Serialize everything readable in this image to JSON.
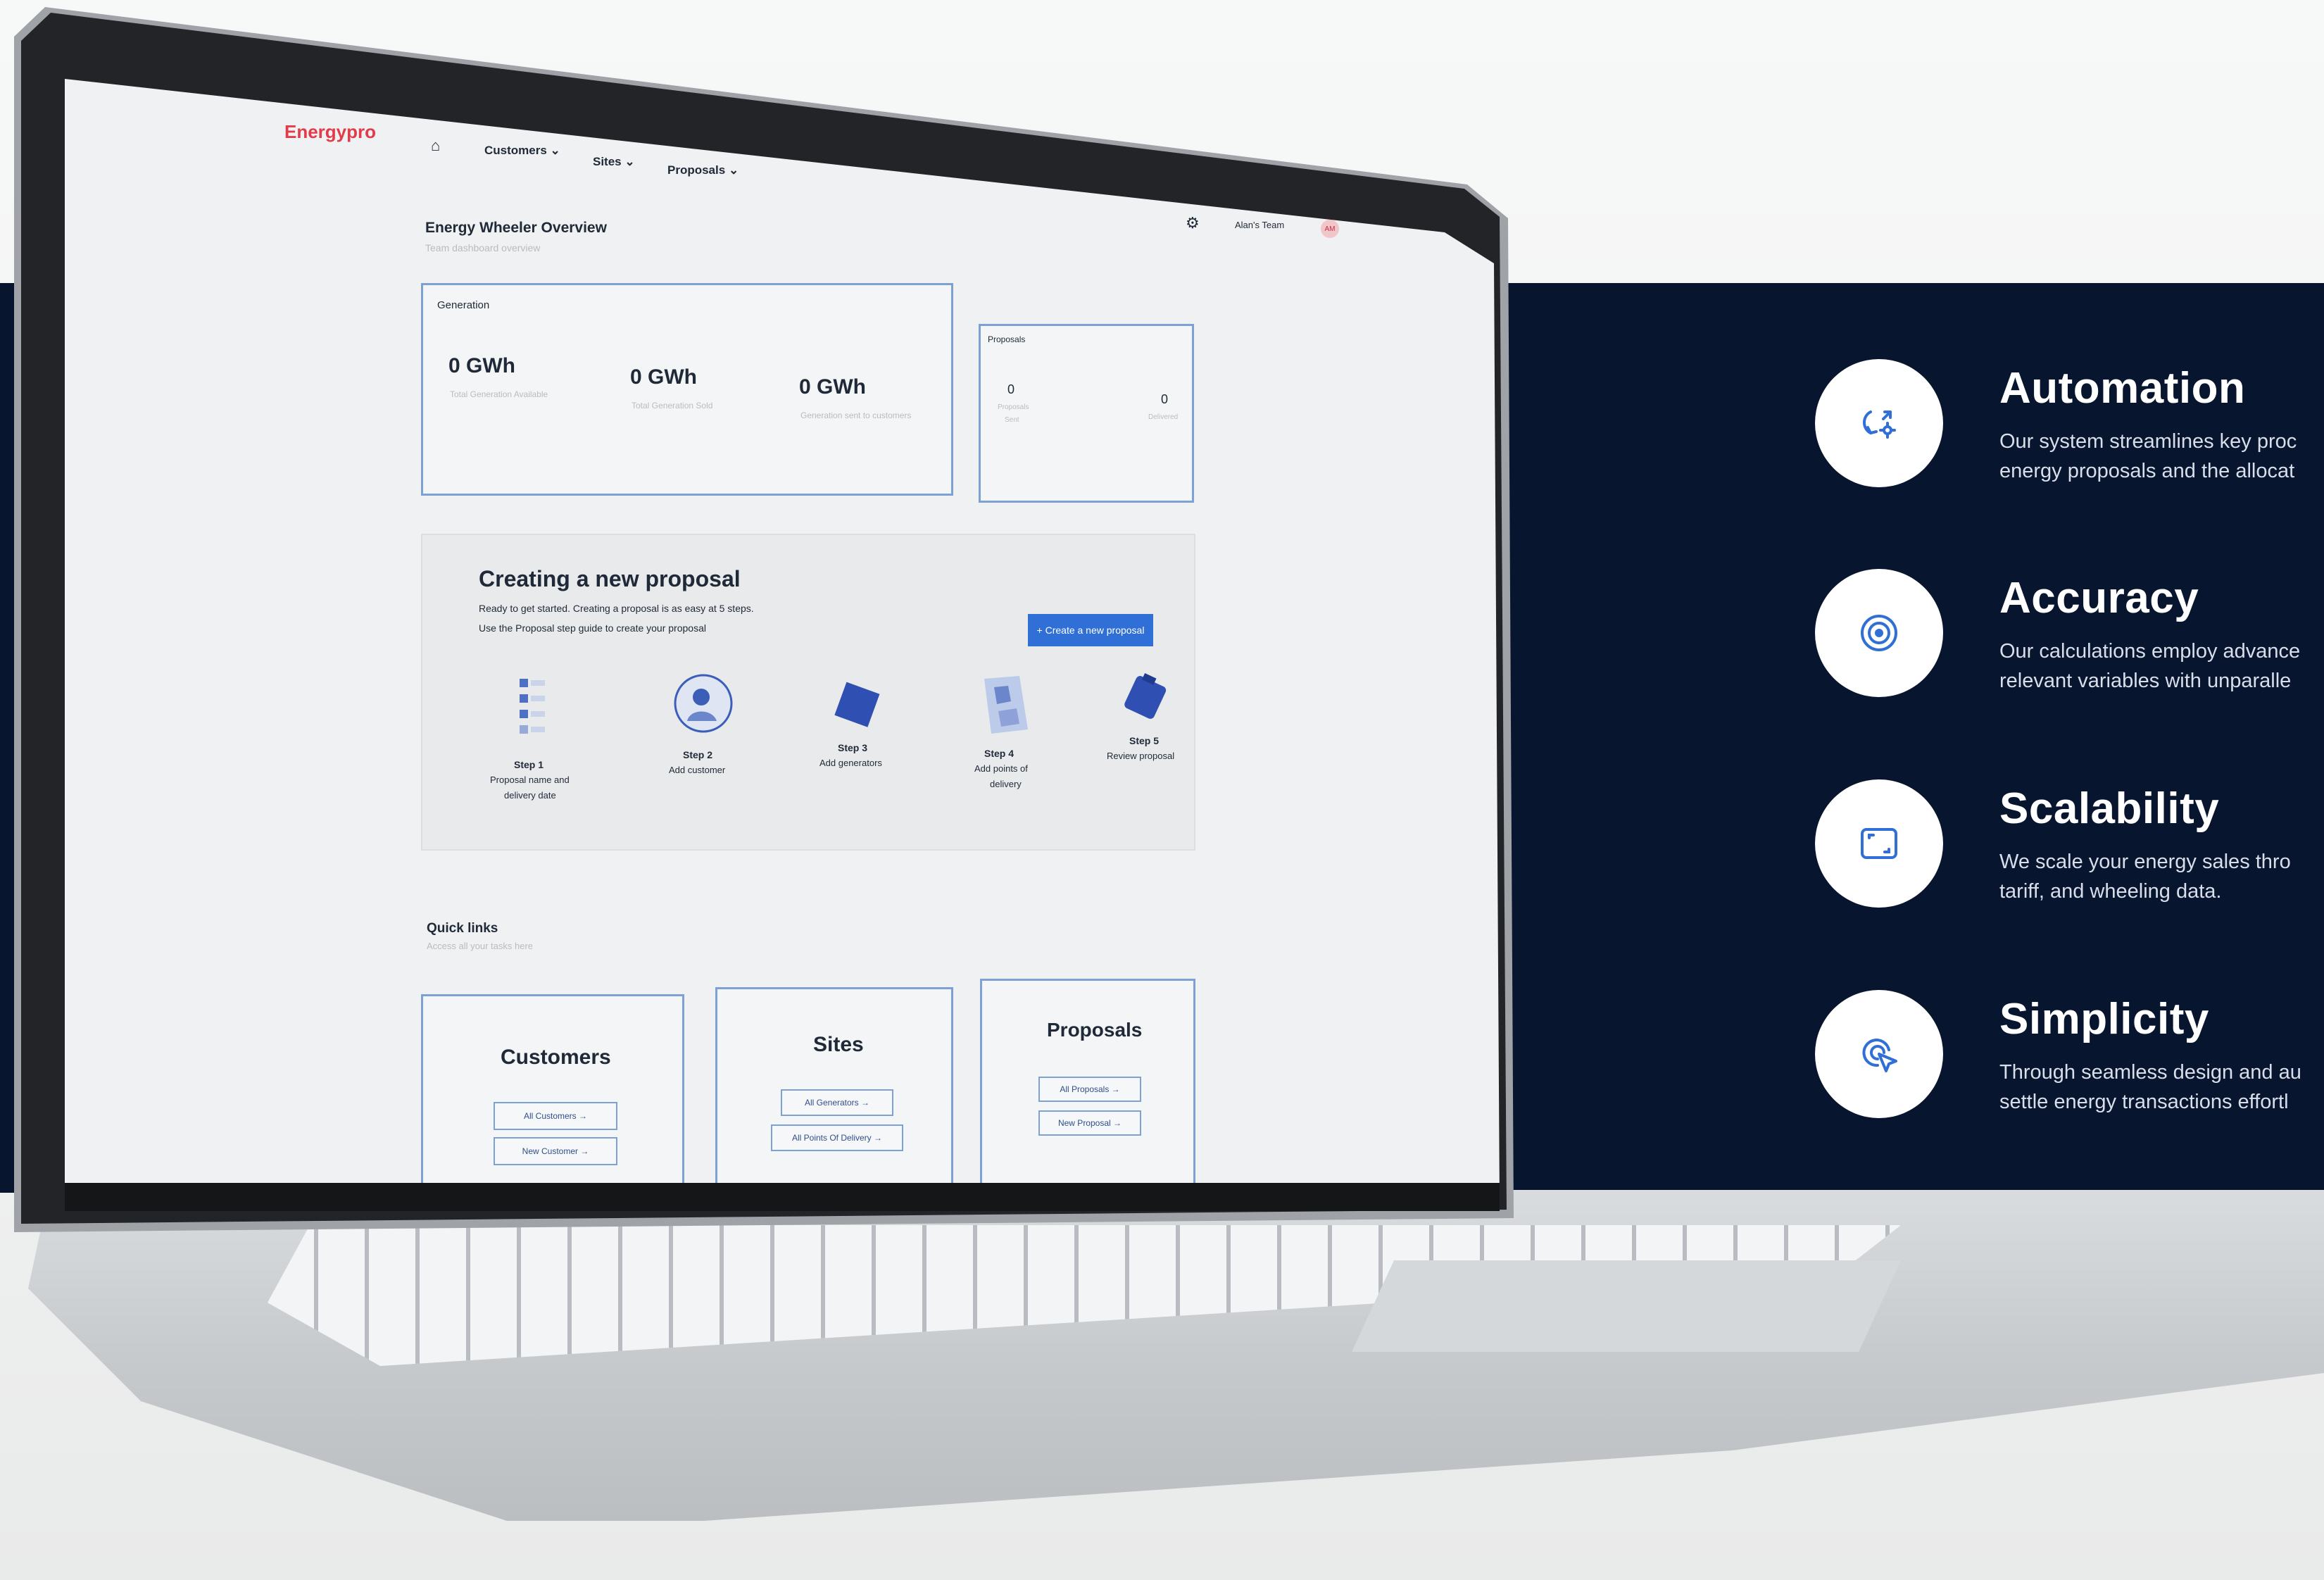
{
  "features": [
    {
      "title": "Automation",
      "desc": [
        "Our system streamlines key proc",
        "energy proposals and the allocat"
      ],
      "icon": "automation-icon"
    },
    {
      "title": "Accuracy",
      "desc": [
        "Our calculations employ advance",
        "relevant variables with unparalle"
      ],
      "icon": "target-icon"
    },
    {
      "title": "Scalability",
      "desc": [
        "We scale your energy sales thro",
        "tariff, and wheeling data."
      ],
      "icon": "scale-frame-icon"
    },
    {
      "title": "Simplicity",
      "desc": [
        "Through seamless design and au",
        "settle energy transactions effortl"
      ],
      "icon": "click-pointer-icon"
    }
  ],
  "app": {
    "logo": "Energypro",
    "nav": [
      "Customers",
      "Sites",
      "Proposals"
    ],
    "team": "Alan's Team",
    "avatar": "AM",
    "page_title": "Energy Wheeler Overview",
    "page_subtitle": "Team dashboard overview",
    "generation": {
      "title": "Generation",
      "stats": [
        {
          "value": "0 GWh",
          "label": "Total Generation Available"
        },
        {
          "value": "0 GWh",
          "label": "Total Generation Sold"
        },
        {
          "value": "0 GWh",
          "label": "Generation sent to customers"
        }
      ]
    },
    "proposals_card": {
      "title": "Proposals",
      "stats": [
        {
          "value": "0",
          "label": "Proposals",
          "label2": "Sent"
        },
        {
          "value": "0",
          "label": "Delivered",
          "label2": ""
        }
      ]
    },
    "create": {
      "title": "Creating a new proposal",
      "line1": "Ready to get started. Creating a proposal is as easy at 5 steps.",
      "line2": "Use the Proposal step guide to create your proposal",
      "button": "+ Create a new proposal",
      "steps": [
        {
          "title": "Step 1",
          "desc": "Proposal name and",
          "desc2": "delivery date"
        },
        {
          "title": "Step 2",
          "desc": "Add customer",
          "desc2": ""
        },
        {
          "title": "Step 3",
          "desc": "Add generators",
          "desc2": ""
        },
        {
          "title": "Step 4",
          "desc": "Add points of",
          "desc2": "delivery"
        },
        {
          "title": "Step 5",
          "desc": "Review proposal",
          "desc2": ""
        }
      ]
    },
    "quick_links": {
      "title": "Quick links",
      "subtitle": "Access all your tasks here",
      "cards": [
        {
          "title": "Customers",
          "links": [
            "All Customers →",
            "New Customer →"
          ]
        },
        {
          "title": "Sites",
          "links": [
            "All Generators →",
            "All Points Of Delivery →"
          ]
        },
        {
          "title": "Proposals",
          "links": [
            "All Proposals →",
            "New Proposal →"
          ]
        }
      ]
    }
  }
}
